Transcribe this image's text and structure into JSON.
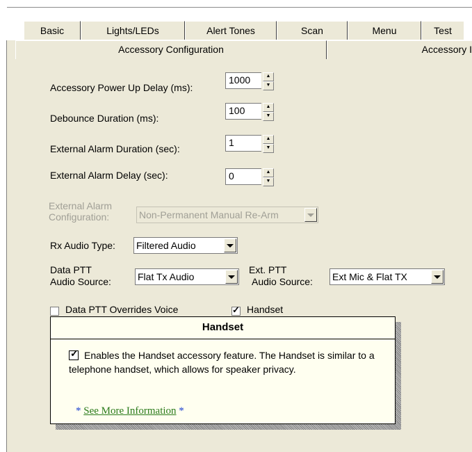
{
  "tabs_row1": [
    "Basic",
    "Lights/LEDs",
    "Alert Tones",
    "Scan",
    "Menu",
    "Test"
  ],
  "tabs_row2": [
    "Accessory Configuration",
    "Accessory I"
  ],
  "fields": {
    "power_up_delay": {
      "label": "Accessory Power Up Delay (ms):",
      "value": "1000"
    },
    "debounce": {
      "label": "Debounce Duration (ms):",
      "value": "100"
    },
    "alarm_duration": {
      "label": "External Alarm Duration (sec):",
      "value": "1"
    },
    "alarm_delay": {
      "label": "External Alarm Delay (sec):",
      "value": "0"
    }
  },
  "alarm_config": {
    "label_line1": "External Alarm",
    "label_line2": "Configuration:",
    "value": "Non-Permanent Manual Re-Arm"
  },
  "rx_audio": {
    "label": "Rx Audio Type:",
    "value": "Filtered Audio"
  },
  "data_ptt": {
    "label_line1": "Data PTT",
    "label_line2": "Audio Source:",
    "value": "Flat Tx Audio"
  },
  "ext_ptt": {
    "label_line1": "Ext. PTT",
    "label_line2": "Audio Source:",
    "value": "Ext Mic & Flat TX"
  },
  "checkboxes": {
    "data_ptt_overrides": {
      "label": "Data PTT Overrides Voice",
      "checked": false
    },
    "handset": {
      "label": "Handset",
      "checked": true
    }
  },
  "tooltip": {
    "title": "Handset",
    "body": "Enables the Handset accessory feature. The Handset is similar to a telephone handset, which allows for speaker privacy.",
    "link": "See More Information",
    "star": "*"
  }
}
